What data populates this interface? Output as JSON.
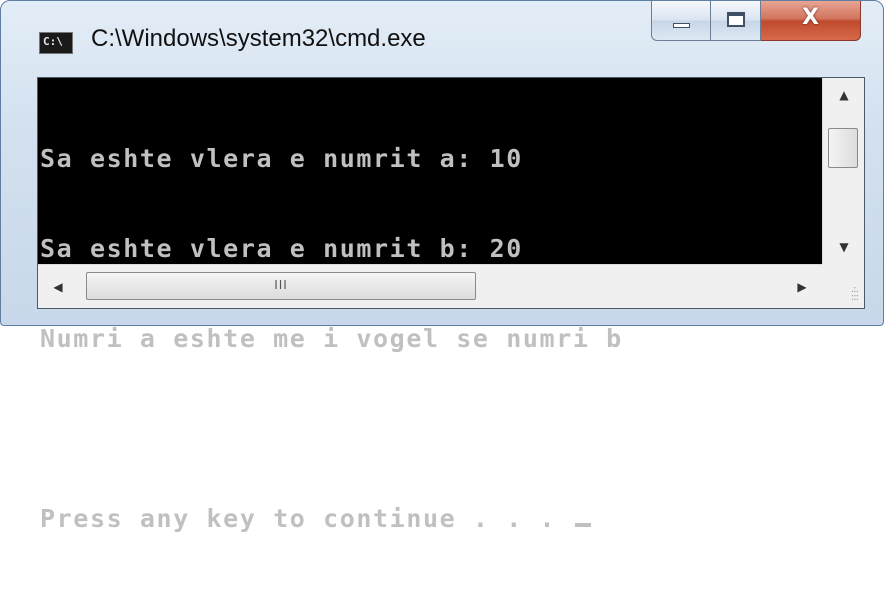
{
  "window": {
    "title": "C:\\Windows\\system32\\cmd.exe",
    "app_icon": "cmd-icon",
    "app_icon_text": "C:\\",
    "close_glyph": "X"
  },
  "console": {
    "lines": [
      "Sa eshte vlera e numrit a: 10",
      "Sa eshte vlera e numrit b: 20",
      "Numri a eshte me i vogel se numri b",
      "",
      "Press any key to continue . . . "
    ],
    "text_color": "#c0c0c0",
    "background": "#000000"
  },
  "scrollbars": {
    "vertical": {
      "up_icon": "scroll-up-arrow-icon",
      "down_icon": "scroll-down-arrow-icon"
    },
    "horizontal": {
      "left_icon": "scroll-left-arrow-icon",
      "right_icon": "scroll-right-arrow-icon",
      "grip": "III"
    }
  }
}
